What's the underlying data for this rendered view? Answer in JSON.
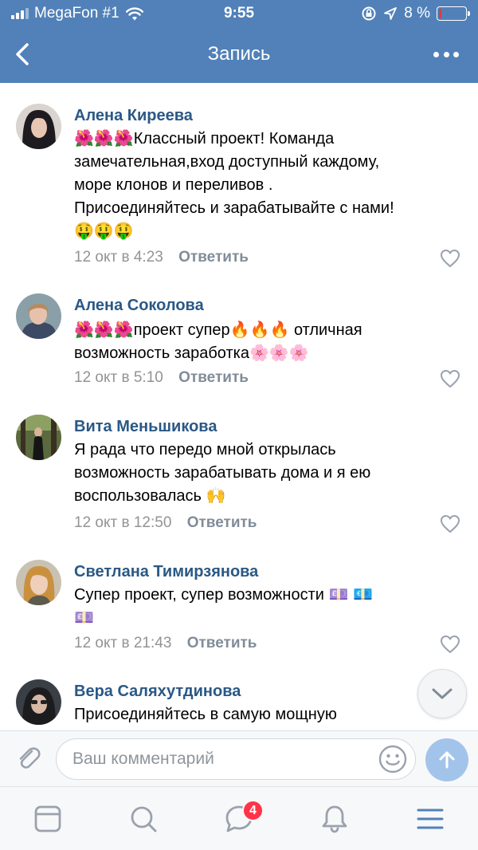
{
  "status_bar": {
    "carrier": "MegaFon #1",
    "time": "9:55",
    "battery": "8 %",
    "battery_level": 0.08
  },
  "header": {
    "title": "Запись"
  },
  "comments": [
    {
      "author": "Алена Киреева",
      "lines": [
        "🌺🌺🌺Классный проект! Команда",
        "замечательная,вход доступный каждому,",
        "море клонов и переливов  .",
        "Присоединяйтесь и зарабатывайте с нами!",
        "🤑🤑🤑"
      ],
      "date": "12 окт в 4:23",
      "reply_label": "Ответить"
    },
    {
      "author": "Алена Соколова",
      "lines": [
        "🌺🌺🌺проект супер🔥🔥🔥 отличная",
        "возможность заработка🌸🌸🌸"
      ],
      "date": "12 окт в 5:10",
      "reply_label": "Ответить"
    },
    {
      "author": "Вита Меньшикова",
      "lines": [
        "Я рада что передо мной открылась",
        "возможность зарабатывать дома и я ею",
        "воспользовалась 🙌"
      ],
      "date": "12 окт в 12:50",
      "reply_label": "Ответить"
    },
    {
      "author": "Светлана Тимирзянова",
      "lines": [
        "Супер проект, супер возможности 💷 💶",
        "💷"
      ],
      "date": "12 окт в 21:43",
      "reply_label": "Ответить"
    },
    {
      "author": "Вера Саляхутдинова",
      "lines": [
        "Присоединяйтесь в самую мощную"
      ],
      "date": "",
      "reply_label": ""
    }
  ],
  "composer": {
    "placeholder": "Ваш комментарий"
  },
  "tabbar": {
    "messages_badge": "4"
  },
  "colors": {
    "header_bg": "#5181b8",
    "author_name": "#2a5885",
    "meta_text": "#939393",
    "reply_text": "#818c99",
    "badge": "#ff3347",
    "send_button": "#a3c4ea"
  }
}
